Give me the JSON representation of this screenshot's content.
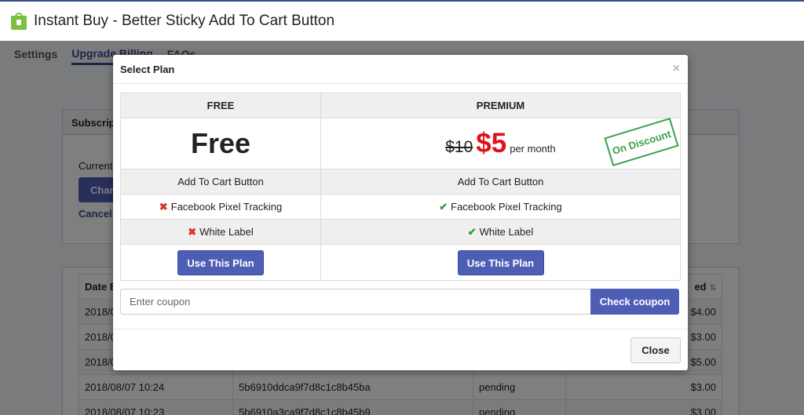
{
  "app": {
    "title": "Instant Buy - Better Sticky Add To Cart Button",
    "logo_icon": "shopping-bag-icon"
  },
  "tabs": [
    {
      "label": "Settings",
      "active": false
    },
    {
      "label": "Upgrade Billing",
      "active": true
    },
    {
      "label": "FAQs",
      "active": false
    }
  ],
  "subscription_card": {
    "header": "Subscription",
    "current_label": "Current",
    "change_button": "Change",
    "cancel_link": "Cancel"
  },
  "charges_table": {
    "headers": [
      "Date B",
      "",
      "",
      "ed"
    ],
    "rows": [
      {
        "date": "2018/0",
        "id": "",
        "status": "",
        "amount": "$4.00"
      },
      {
        "date": "2018/0",
        "id": "",
        "status": "",
        "amount": "$3.00"
      },
      {
        "date": "2018/0",
        "id": "",
        "status": "",
        "amount": "$5.00"
      },
      {
        "date": "2018/08/07 10:24",
        "id": "5b6910ddca9f7d8c1c8b45ba",
        "status": "pending",
        "amount": "$3.00"
      },
      {
        "date": "2018/08/07 10:23",
        "id": "5b6910a3ca9f7d8c1c8b45b9",
        "status": "pending",
        "amount": "$3.00"
      }
    ]
  },
  "modal": {
    "title": "Select Plan",
    "close_glyph": "×",
    "plans": {
      "free": {
        "name": "FREE",
        "price_text": "Free",
        "features": [
          {
            "label": "Add To Cart Button",
            "included": null
          },
          {
            "label": "Facebook Pixel Tracking",
            "included": false
          },
          {
            "label": "White Label",
            "included": false
          }
        ],
        "button": "Use This Plan"
      },
      "premium": {
        "name": "PREMIUM",
        "old_price": "$10",
        "new_price": "$5",
        "period": "per month",
        "stamp": "On Discount",
        "features": [
          {
            "label": "Add To Cart Button",
            "included": null
          },
          {
            "label": "Facebook Pixel Tracking",
            "included": true
          },
          {
            "label": "White Label",
            "included": true
          }
        ],
        "button": "Use This Plan"
      }
    },
    "coupon": {
      "placeholder": "Enter coupon",
      "value": "",
      "button": "Check coupon"
    },
    "close_button": "Close"
  },
  "colors": {
    "primary": "#4f5eb5",
    "price_red": "#e0101a",
    "check_green": "#2a9e3f",
    "x_red": "#d9332a",
    "stamp_green": "#3aa14a"
  }
}
